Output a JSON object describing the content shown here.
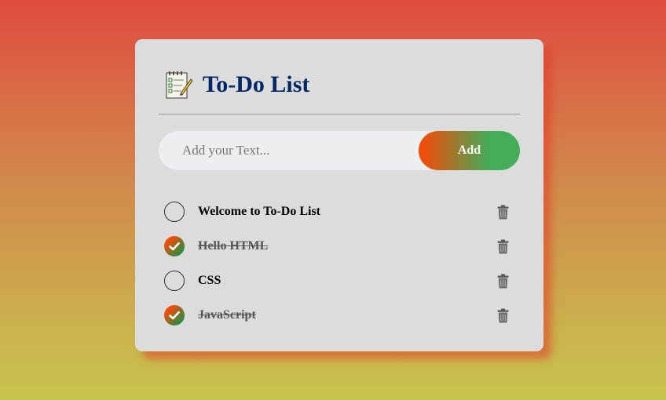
{
  "app": {
    "title": "To-Do List",
    "icon": "notepad-icon"
  },
  "input": {
    "placeholder": "Add your Text...",
    "value": ""
  },
  "add_button": {
    "label": "Add"
  },
  "colors": {
    "title": "#002765",
    "card": "#dcdcdc",
    "button_start": "#ee4d0b",
    "button_end": "#43ad59"
  },
  "tasks": [
    {
      "label": "Welcome to To-Do List",
      "checked": false
    },
    {
      "label": "Hello HTML",
      "checked": true
    },
    {
      "label": "CSS",
      "checked": false
    },
    {
      "label": "JavaScript",
      "checked": true
    }
  ]
}
